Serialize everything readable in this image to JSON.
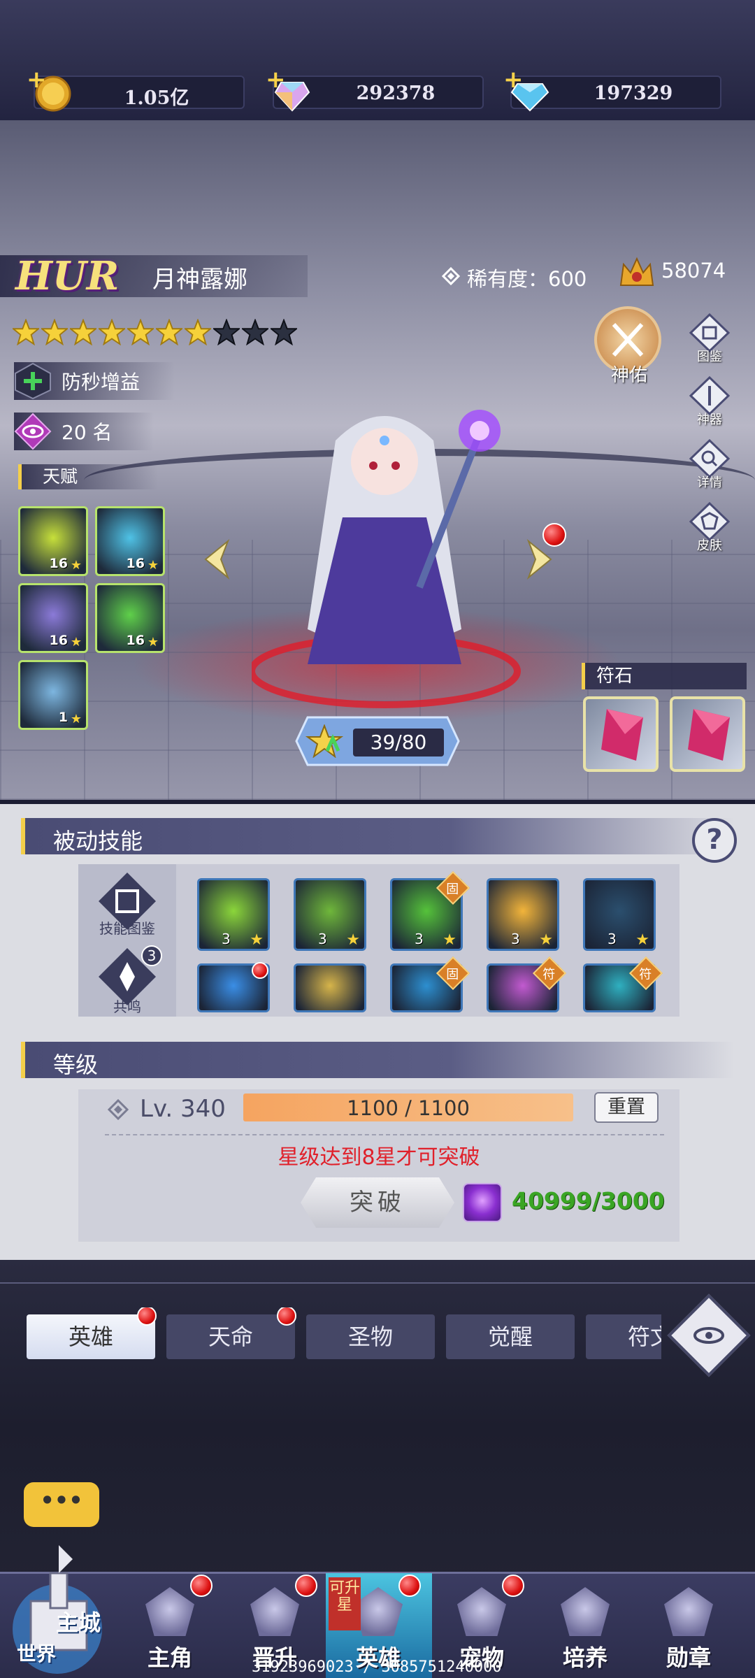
{
  "currency": {
    "gold": "1.05亿",
    "crystal": "292378",
    "diamond": "197329"
  },
  "hero": {
    "grade": "HUR",
    "name": "月神露娜",
    "rarity": "稀有度：600",
    "power": "58074",
    "stars_filled": 7,
    "stars_total": 10,
    "buff": "防秒增益",
    "rank": "20 名",
    "talent_label": "天赋",
    "talents": [
      {
        "level": "16",
        "color": "#c7e03a"
      },
      {
        "level": "16",
        "color": "#4fc2e6"
      },
      {
        "level": "16",
        "color": "#8b7ad8"
      },
      {
        "level": "16",
        "color": "#5fd04a"
      },
      {
        "level": "1",
        "color": "#7db6e0"
      }
    ],
    "side_buttons": [
      "图鉴",
      "神器",
      "详情",
      "皮肤"
    ],
    "blessing": "神佑",
    "exp": "39/80",
    "rune_label": "符石"
  },
  "passive": {
    "title": "被动技能",
    "help": "?",
    "side_labels": [
      "技能图鉴",
      "共鸣"
    ],
    "resonance_count": "3",
    "skills_row1": [
      {
        "level": "3",
        "color": "#8bd63a",
        "badge": ""
      },
      {
        "level": "3",
        "color": "#6fb73a",
        "badge": ""
      },
      {
        "level": "3",
        "color": "#55c23a",
        "badge": "固"
      },
      {
        "level": "3",
        "color": "#f2b43a",
        "badge": ""
      },
      {
        "level": "3",
        "color": "#2b4f6e",
        "badge": ""
      }
    ],
    "skills_row2": [
      {
        "color": "#3a8ee6",
        "badge": ""
      },
      {
        "color": "#d6b44a",
        "badge": ""
      },
      {
        "color": "#2d8fd0",
        "badge": "固"
      },
      {
        "color": "#c25ad0",
        "badge": "符"
      },
      {
        "color": "#2fb0c0",
        "badge": "符"
      }
    ]
  },
  "level": {
    "title": "等级",
    "lv": "Lv. 340",
    "progress": "1100 / 1100",
    "progress_fraction": 1.0,
    "reset": "重置",
    "note": "星级达到8星才可突破",
    "break_button": "突破",
    "cost": "40999/3000"
  },
  "tabs": [
    {
      "label": "英雄",
      "active": true,
      "dot": true
    },
    {
      "label": "天命",
      "active": false,
      "dot": true
    },
    {
      "label": "圣物",
      "active": false,
      "dot": false
    },
    {
      "label": "觉醒",
      "active": false,
      "dot": false
    },
    {
      "label": "符文",
      "active": false,
      "dot": false
    }
  ],
  "chat": "•••",
  "nav": {
    "castle": "主城",
    "world": "世界",
    "items": [
      {
        "label": "主角",
        "dot": true
      },
      {
        "label": "晋升",
        "dot": true
      },
      {
        "label": "英雄",
        "dot": true,
        "ribbon": "可升星"
      },
      {
        "label": "宠物",
        "dot": true
      },
      {
        "label": "培养",
        "dot": false
      },
      {
        "label": "勋章",
        "dot": false
      }
    ]
  },
  "debug": "31923969023 / 3085751240000",
  "colors": {
    "accent": "#f4cf4a",
    "panel": "#dcdde3",
    "header": "#4a4c74"
  }
}
